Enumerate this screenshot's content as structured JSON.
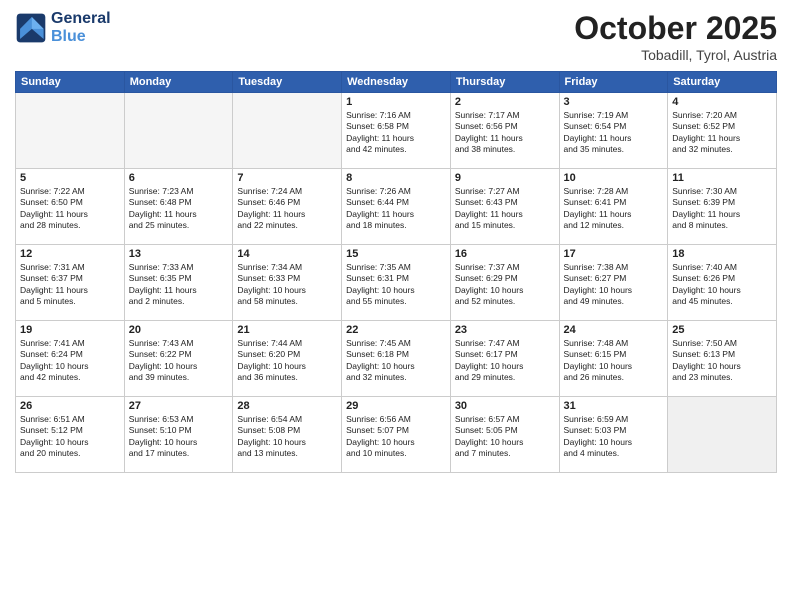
{
  "header": {
    "logo_line1": "General",
    "logo_line2": "Blue",
    "month": "October 2025",
    "location": "Tobadill, Tyrol, Austria"
  },
  "weekdays": [
    "Sunday",
    "Monday",
    "Tuesday",
    "Wednesday",
    "Thursday",
    "Friday",
    "Saturday"
  ],
  "weeks": [
    [
      {
        "day": "",
        "info": ""
      },
      {
        "day": "",
        "info": ""
      },
      {
        "day": "",
        "info": ""
      },
      {
        "day": "1",
        "info": "Sunrise: 7:16 AM\nSunset: 6:58 PM\nDaylight: 11 hours\nand 42 minutes."
      },
      {
        "day": "2",
        "info": "Sunrise: 7:17 AM\nSunset: 6:56 PM\nDaylight: 11 hours\nand 38 minutes."
      },
      {
        "day": "3",
        "info": "Sunrise: 7:19 AM\nSunset: 6:54 PM\nDaylight: 11 hours\nand 35 minutes."
      },
      {
        "day": "4",
        "info": "Sunrise: 7:20 AM\nSunset: 6:52 PM\nDaylight: 11 hours\nand 32 minutes."
      }
    ],
    [
      {
        "day": "5",
        "info": "Sunrise: 7:22 AM\nSunset: 6:50 PM\nDaylight: 11 hours\nand 28 minutes."
      },
      {
        "day": "6",
        "info": "Sunrise: 7:23 AM\nSunset: 6:48 PM\nDaylight: 11 hours\nand 25 minutes."
      },
      {
        "day": "7",
        "info": "Sunrise: 7:24 AM\nSunset: 6:46 PM\nDaylight: 11 hours\nand 22 minutes."
      },
      {
        "day": "8",
        "info": "Sunrise: 7:26 AM\nSunset: 6:44 PM\nDaylight: 11 hours\nand 18 minutes."
      },
      {
        "day": "9",
        "info": "Sunrise: 7:27 AM\nSunset: 6:43 PM\nDaylight: 11 hours\nand 15 minutes."
      },
      {
        "day": "10",
        "info": "Sunrise: 7:28 AM\nSunset: 6:41 PM\nDaylight: 11 hours\nand 12 minutes."
      },
      {
        "day": "11",
        "info": "Sunrise: 7:30 AM\nSunset: 6:39 PM\nDaylight: 11 hours\nand 8 minutes."
      }
    ],
    [
      {
        "day": "12",
        "info": "Sunrise: 7:31 AM\nSunset: 6:37 PM\nDaylight: 11 hours\nand 5 minutes."
      },
      {
        "day": "13",
        "info": "Sunrise: 7:33 AM\nSunset: 6:35 PM\nDaylight: 11 hours\nand 2 minutes."
      },
      {
        "day": "14",
        "info": "Sunrise: 7:34 AM\nSunset: 6:33 PM\nDaylight: 10 hours\nand 58 minutes."
      },
      {
        "day": "15",
        "info": "Sunrise: 7:35 AM\nSunset: 6:31 PM\nDaylight: 10 hours\nand 55 minutes."
      },
      {
        "day": "16",
        "info": "Sunrise: 7:37 AM\nSunset: 6:29 PM\nDaylight: 10 hours\nand 52 minutes."
      },
      {
        "day": "17",
        "info": "Sunrise: 7:38 AM\nSunset: 6:27 PM\nDaylight: 10 hours\nand 49 minutes."
      },
      {
        "day": "18",
        "info": "Sunrise: 7:40 AM\nSunset: 6:26 PM\nDaylight: 10 hours\nand 45 minutes."
      }
    ],
    [
      {
        "day": "19",
        "info": "Sunrise: 7:41 AM\nSunset: 6:24 PM\nDaylight: 10 hours\nand 42 minutes."
      },
      {
        "day": "20",
        "info": "Sunrise: 7:43 AM\nSunset: 6:22 PM\nDaylight: 10 hours\nand 39 minutes."
      },
      {
        "day": "21",
        "info": "Sunrise: 7:44 AM\nSunset: 6:20 PM\nDaylight: 10 hours\nand 36 minutes."
      },
      {
        "day": "22",
        "info": "Sunrise: 7:45 AM\nSunset: 6:18 PM\nDaylight: 10 hours\nand 32 minutes."
      },
      {
        "day": "23",
        "info": "Sunrise: 7:47 AM\nSunset: 6:17 PM\nDaylight: 10 hours\nand 29 minutes."
      },
      {
        "day": "24",
        "info": "Sunrise: 7:48 AM\nSunset: 6:15 PM\nDaylight: 10 hours\nand 26 minutes."
      },
      {
        "day": "25",
        "info": "Sunrise: 7:50 AM\nSunset: 6:13 PM\nDaylight: 10 hours\nand 23 minutes."
      }
    ],
    [
      {
        "day": "26",
        "info": "Sunrise: 6:51 AM\nSunset: 5:12 PM\nDaylight: 10 hours\nand 20 minutes."
      },
      {
        "day": "27",
        "info": "Sunrise: 6:53 AM\nSunset: 5:10 PM\nDaylight: 10 hours\nand 17 minutes."
      },
      {
        "day": "28",
        "info": "Sunrise: 6:54 AM\nSunset: 5:08 PM\nDaylight: 10 hours\nand 13 minutes."
      },
      {
        "day": "29",
        "info": "Sunrise: 6:56 AM\nSunset: 5:07 PM\nDaylight: 10 hours\nand 10 minutes."
      },
      {
        "day": "30",
        "info": "Sunrise: 6:57 AM\nSunset: 5:05 PM\nDaylight: 10 hours\nand 7 minutes."
      },
      {
        "day": "31",
        "info": "Sunrise: 6:59 AM\nSunset: 5:03 PM\nDaylight: 10 hours\nand 4 minutes."
      },
      {
        "day": "",
        "info": ""
      }
    ]
  ]
}
